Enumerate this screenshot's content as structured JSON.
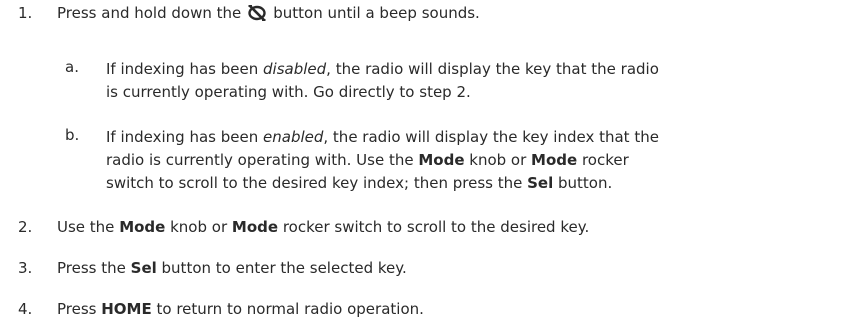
{
  "steps": [
    {
      "number": "1.",
      "text_before_icon": "Press and hold down the",
      "icon": "key-fill-icon",
      "text_after_icon": "button until a beep sounds.",
      "substeps": [
        {
          "letter": "a.",
          "line1_pre": "If indexing has been ",
          "line1_em": "disabled",
          "line1_post": ", the radio will display the key that the radio",
          "line2": "is currently operating with. Go directly to step 2."
        },
        {
          "letter": "b.",
          "line1_pre": "If indexing has been ",
          "line1_em": "enabled",
          "line1_post": ", the radio will display the key index that the",
          "line2_pre": "radio is currently operating with. Use the ",
          "line2_b1": "Mode",
          "line2_mid": " knob or ",
          "line2_b2": "Mode",
          "line2_post": " rocker",
          "line3_pre": "switch to scroll to the desired key index; then press the ",
          "line3_b": "Sel",
          "line3_post": " button."
        }
      ]
    },
    {
      "number": "2.",
      "pre": "Use the ",
      "b1": "Mode",
      "mid": " knob or ",
      "b2": "Mode",
      "post": " rocker switch to scroll to the desired key."
    },
    {
      "number": "3.",
      "pre": "Press the ",
      "b": "Sel",
      "post": " button to enter the selected key."
    },
    {
      "number": "4.",
      "pre": "Press ",
      "b": "HOME",
      "post": " to return to normal radio operation."
    }
  ]
}
